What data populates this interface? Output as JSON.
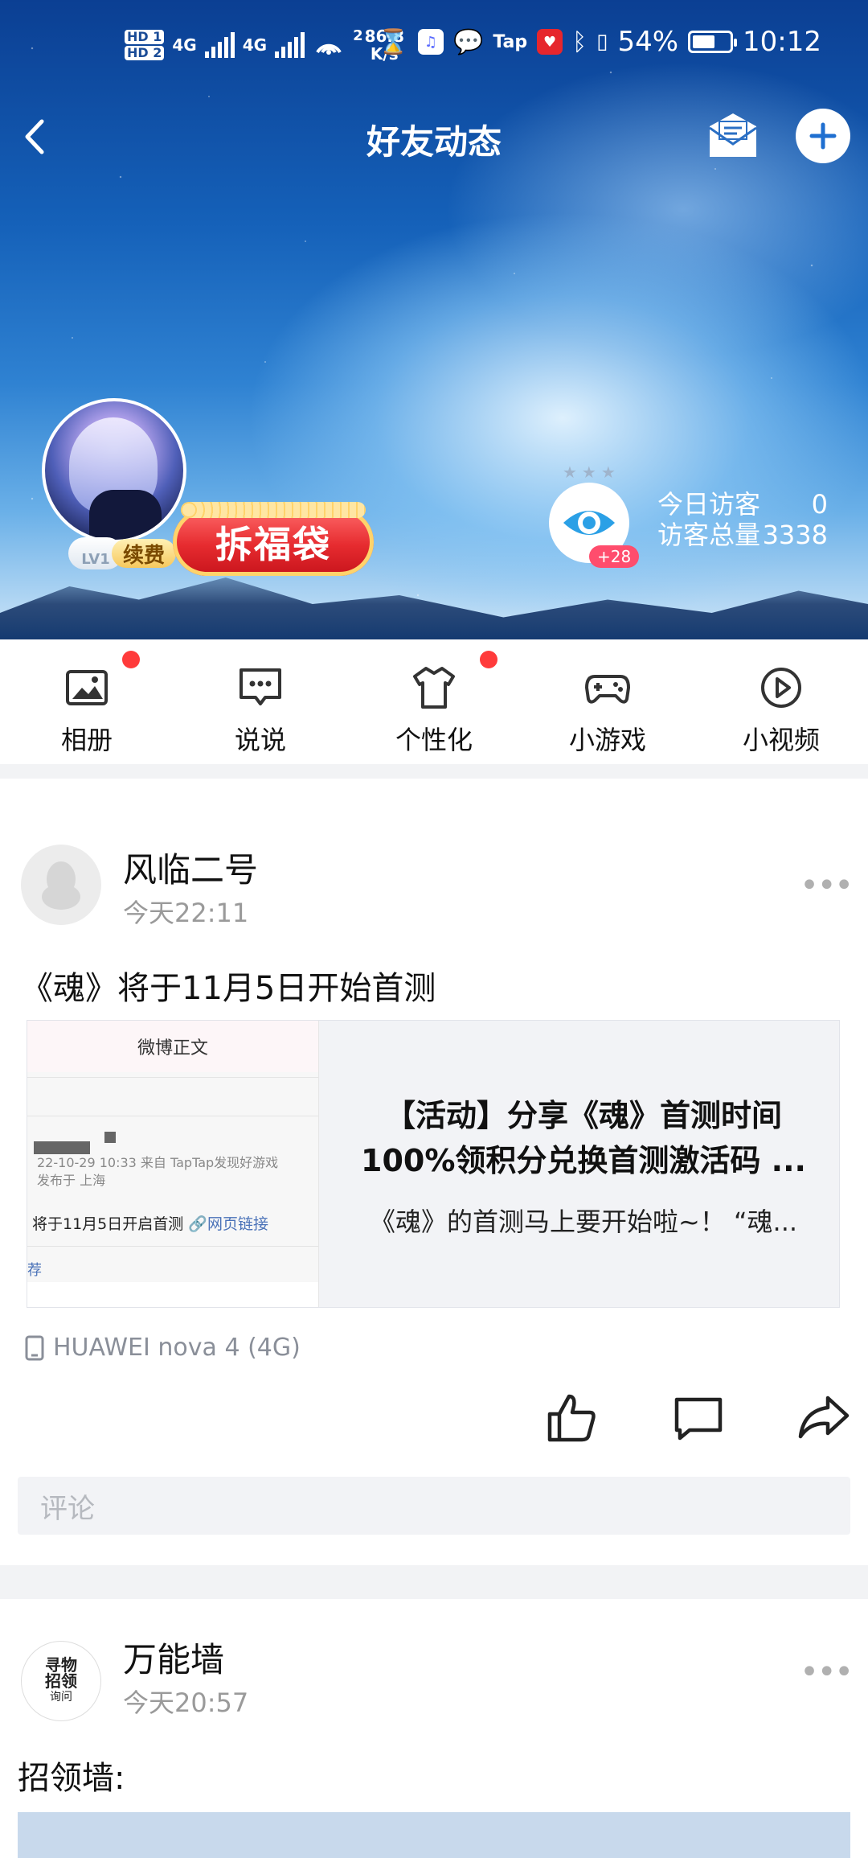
{
  "statusbar": {
    "hd1": "HD 1",
    "hd2": "HD 2",
    "net1": "4G",
    "net2": "4G",
    "speed": "86.8",
    "speed_unit": "K/s",
    "speed_prefix": "2",
    "taptap": "Tap",
    "battery": "54%",
    "time": "10:12"
  },
  "nav": {
    "title": "好友动态"
  },
  "profile": {
    "level": "LV1",
    "renew": "续费",
    "fudai": "拆福袋",
    "eye_badge": "+28",
    "today_label": "今日访客",
    "today_value": "0",
    "total_label": "访客总量",
    "total_value": "3338"
  },
  "tabs": [
    {
      "label": "相册",
      "icon": "photo-album-icon",
      "dot": true
    },
    {
      "label": "说说",
      "icon": "chat-bubble-icon",
      "dot": false
    },
    {
      "label": "个性化",
      "icon": "tshirt-icon",
      "dot": true
    },
    {
      "label": "小游戏",
      "icon": "gamepad-icon",
      "dot": false
    },
    {
      "label": "小视频",
      "icon": "play-circle-icon",
      "dot": false
    }
  ],
  "post1": {
    "author": "风临二号",
    "time": "今天22:11",
    "text": "《魂》将于11月5日开始首测",
    "thumb_header": "微博正文",
    "thumb_meta1": "22-10-29 10:33  来自 TapTap发现好游戏",
    "thumb_meta2": "发布于 上海",
    "thumb_line": "将于11月5日开启首测",
    "thumb_link": "🔗网页链接",
    "thumb_rec": "荐",
    "link_title_1": "【活动】分享《魂》首测时间",
    "link_title_2": "100%领积分兑换首测激活码 ...",
    "link_desc": "《魂》的首测马上要开始啦~！ “魂...",
    "device": "HUAWEI nova 4 (4G)",
    "comment_placeholder": "评论"
  },
  "post2": {
    "author": "万能墙",
    "time": "今天20:57",
    "text": "招领墙:",
    "avatar_text_1": "寻物",
    "avatar_text_2": "招领",
    "avatar_text_3": "询问"
  },
  "colors": {
    "accent_red": "#ff3b3b",
    "sky_blue": "#1561b9"
  }
}
